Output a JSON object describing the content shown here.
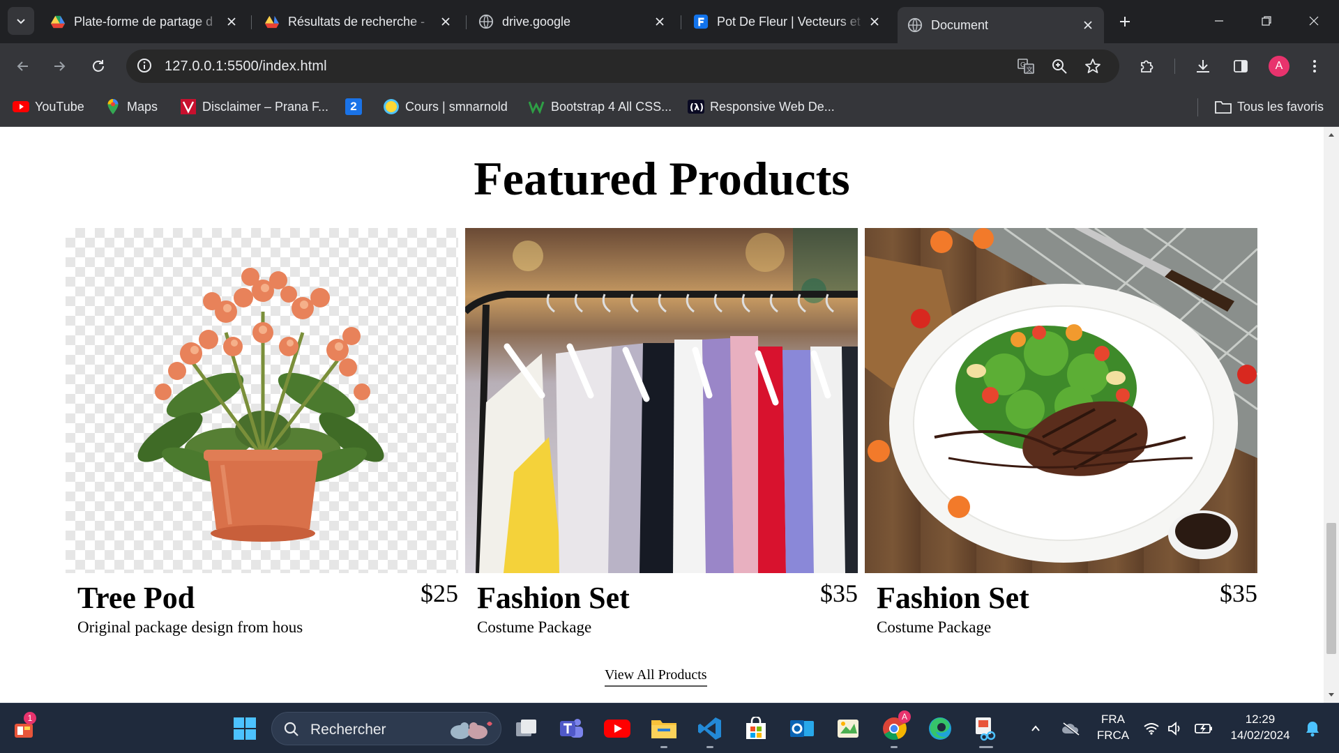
{
  "browser": {
    "tabs": [
      {
        "title": "Plate-forme de partage d",
        "icon": "google-drive-icon",
        "active": false
      },
      {
        "title": "Résultats de recherche -",
        "icon": "google-drive-icon",
        "active": false
      },
      {
        "title": "drive.google",
        "icon": "globe-icon",
        "active": false
      },
      {
        "title": "Pot De Fleur | Vecteurs et",
        "icon": "freepik-icon",
        "active": false
      },
      {
        "title": "Document",
        "icon": "globe-icon",
        "active": true
      }
    ],
    "url": "127.0.0.1:5500/index.html",
    "profile_initial": "A",
    "profile_color": "#e8336d",
    "bookmarks": [
      {
        "label": "YouTube",
        "icon": "youtube-icon"
      },
      {
        "label": "Maps",
        "icon": "maps-pin-icon"
      },
      {
        "label": "Disclaimer – Prana F...",
        "icon": "prana-icon"
      },
      {
        "label": "",
        "icon": "number-2-icon"
      },
      {
        "label": "Cours | smnarnold",
        "icon": "smnarnold-icon"
      },
      {
        "label": "Bootstrap 4 All CSS...",
        "icon": "w-logo-icon"
      },
      {
        "label": "Responsive Web De...",
        "icon": "freecodecamp-icon"
      }
    ],
    "all_bookmarks_label": "Tous les favoris",
    "number_badge": "2"
  },
  "page": {
    "heading": "Featured Products",
    "products": [
      {
        "name": "Tree Pod",
        "price": "$25",
        "description": "Original package design from hous",
        "image": "potted-flower"
      },
      {
        "name": "Fashion Set",
        "price": "$35",
        "description": "Costume Package",
        "image": "clothing-rack"
      },
      {
        "name": "Fashion Set",
        "price": "$35",
        "description": "Costume Package",
        "image": "steak-salad-plate"
      }
    ],
    "view_all_label": "View All Products"
  },
  "taskbar": {
    "search_placeholder": "Rechercher",
    "widgets_badge": "1",
    "chrome_badge": "A",
    "language_top": "FRA",
    "language_bottom": "FRCA",
    "time": "12:29",
    "date": "14/02/2024"
  },
  "colors": {
    "browser_bg": "#202124",
    "toolbar_bg": "#35363a",
    "page_bg": "#ffffff",
    "taskbar_bg": "#1f2a3c"
  }
}
